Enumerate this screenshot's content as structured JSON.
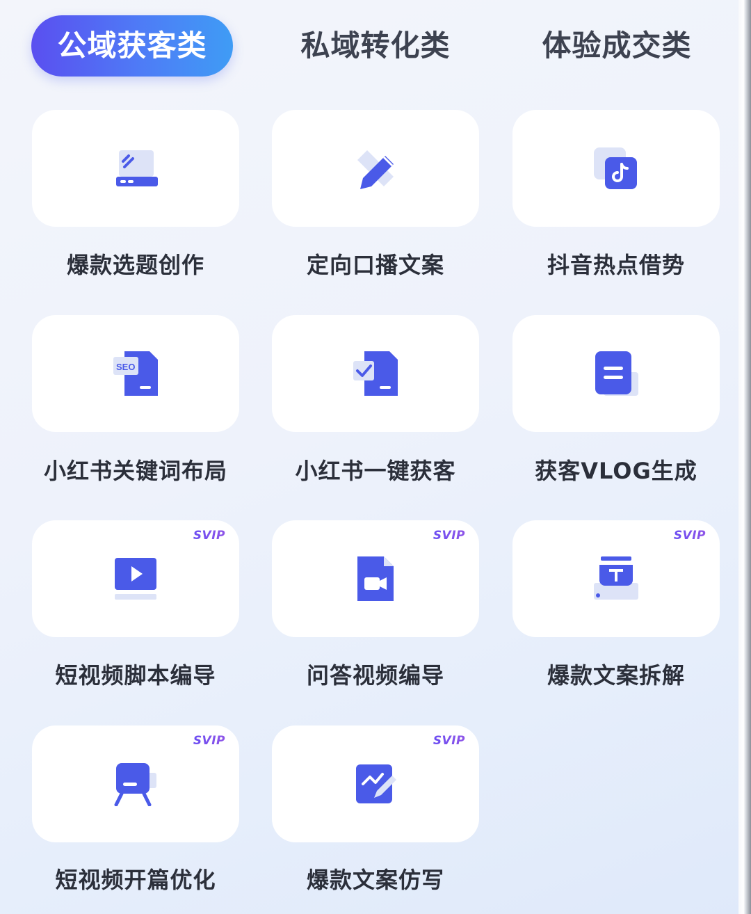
{
  "tabs": [
    {
      "label": "公域获客类",
      "active": true
    },
    {
      "label": "私域转化类",
      "active": false
    },
    {
      "label": "体验成交类",
      "active": false
    }
  ],
  "tools": [
    {
      "label": "爆款选题创作",
      "icon": "laptop-topic-icon",
      "badge": ""
    },
    {
      "label": "定向口播文案",
      "icon": "pencil-icon",
      "badge": ""
    },
    {
      "label": "抖音热点借势",
      "icon": "douyin-icon",
      "badge": ""
    },
    {
      "label": "小红书关键词布局",
      "icon": "seo-doc-icon",
      "badge": "",
      "icon_text": "SEO"
    },
    {
      "label": "小红书一键获客",
      "icon": "check-doc-icon",
      "badge": ""
    },
    {
      "label": "获客VLOG生成",
      "icon": "document-icon",
      "badge": ""
    },
    {
      "label": "短视频脚本编导",
      "icon": "play-video-icon",
      "badge": "SVIP"
    },
    {
      "label": "问答视频编导",
      "icon": "video-file-icon",
      "badge": "SVIP"
    },
    {
      "label": "爆款文案拆解",
      "icon": "text-tool-icon",
      "badge": "SVIP"
    },
    {
      "label": "短视频开篇优化",
      "icon": "presenter-board-icon",
      "badge": "SVIP"
    },
    {
      "label": "爆款文案仿写",
      "icon": "edit-chart-icon",
      "badge": "SVIP"
    }
  ],
  "colors": {
    "accent": "#4a5ae8",
    "accent_light": "#dde3f7",
    "tab_gradient_start": "#5a4ff0",
    "tab_gradient_end": "#3f9cf5",
    "svip": "#7a4ff0"
  }
}
